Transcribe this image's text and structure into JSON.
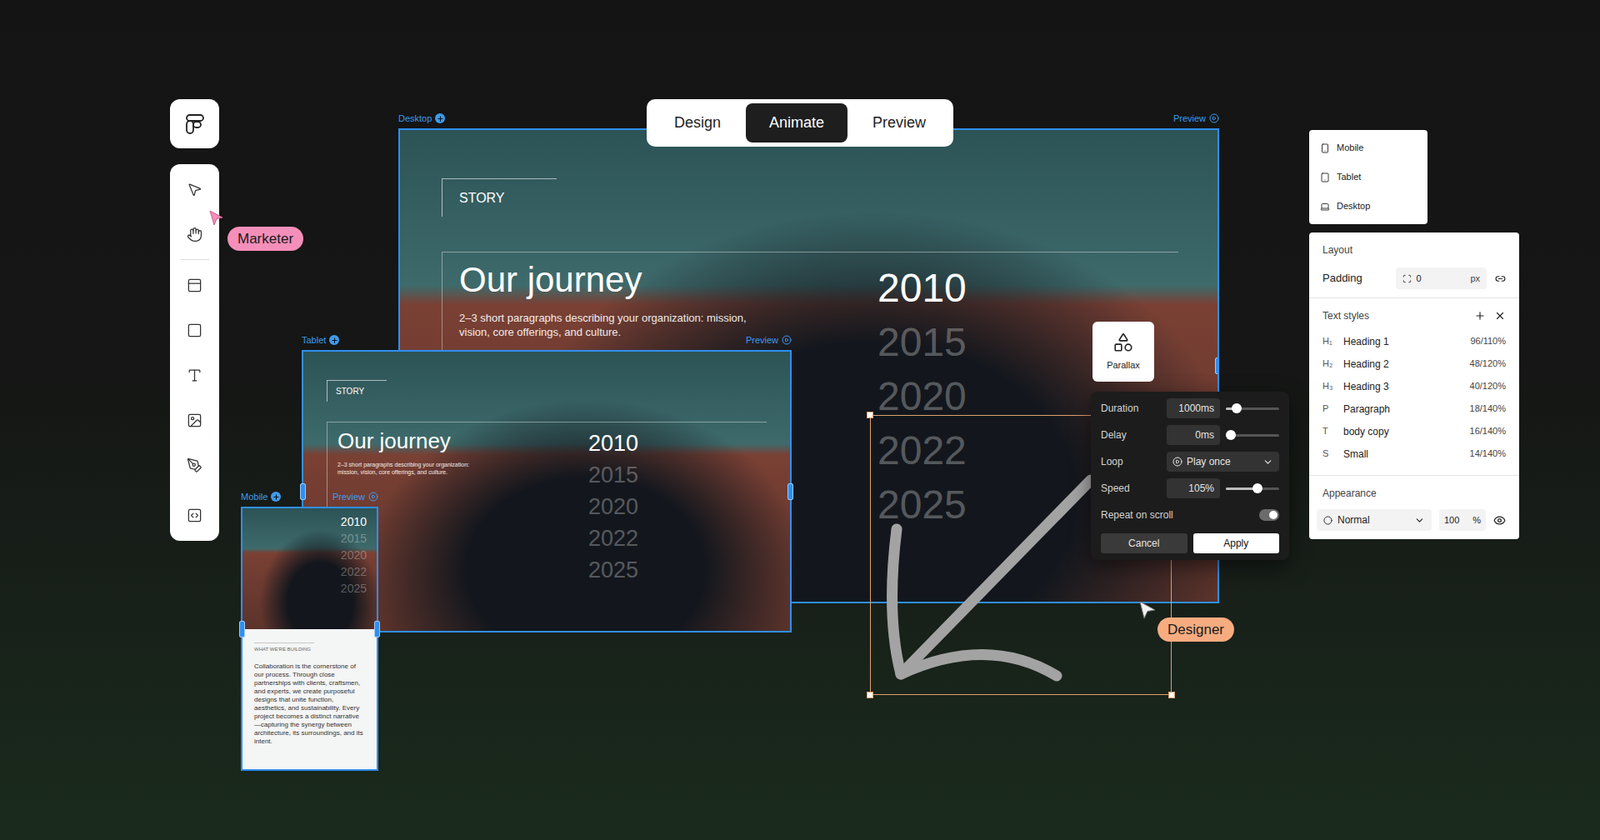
{
  "mode_tabs": [
    {
      "label": "Design",
      "selected": false
    },
    {
      "label": "Animate",
      "selected": true
    },
    {
      "label": "Preview",
      "selected": false
    }
  ],
  "cursors": [
    {
      "label": "Marketer",
      "color": "#f48fb9"
    },
    {
      "label": "Designer",
      "color": "#f7ac80"
    }
  ],
  "frames": {
    "desktop": {
      "label": "Desktop",
      "preview": "Preview",
      "section": "STORY",
      "heading": "Our journey",
      "body": "2–3 short paragraphs describing your organization: mission, vision, core offerings, and culture.",
      "years": [
        {
          "label": "2010",
          "selected": true
        },
        {
          "label": "2015",
          "selected": false
        },
        {
          "label": "2020",
          "selected": false
        },
        {
          "label": "2022",
          "selected": false
        },
        {
          "label": "2025",
          "selected": false
        }
      ]
    },
    "tablet": {
      "label": "Tablet",
      "preview": "Preview",
      "section": "STORY",
      "heading": "Our journey",
      "body": "2–3 short paragraphs describing your organization: mission, vision, core offerings, and culture.",
      "years": [
        {
          "label": "2010",
          "selected": true
        },
        {
          "label": "2015",
          "selected": false
        },
        {
          "label": "2020",
          "selected": false
        },
        {
          "label": "2022",
          "selected": false
        },
        {
          "label": "2025",
          "selected": false
        }
      ]
    },
    "mobile": {
      "label": "Mobile",
      "preview": "Preview",
      "years": [
        {
          "label": "2010",
          "selected": true
        },
        {
          "label": "2015",
          "selected": false
        },
        {
          "label": "2020",
          "selected": false
        },
        {
          "label": "2022",
          "selected": false
        },
        {
          "label": "2025",
          "selected": false
        }
      ],
      "card": {
        "eyebrow": "WHAT WE'RE BUILDING",
        "body": "Collaboration is the cornerstone of our process. Through close partnerships with clients, craftsmen, and experts, we create purposeful designs that unite function, aesthetics, and sustainability. Every project becomes a distinct narrative —capturing the synergy between architecture, its surroundings, and its intent."
      }
    }
  },
  "parallax": {
    "label": "Parallax"
  },
  "animation": {
    "fields": [
      {
        "label": "Duration",
        "value": "1000ms",
        "kind": "slider",
        "level": 0.2
      },
      {
        "label": "Delay",
        "value": "0ms",
        "kind": "slider",
        "level": 0
      },
      {
        "label": "Loop",
        "value": "Play once",
        "kind": "select"
      },
      {
        "label": "Speed",
        "value": "105%",
        "kind": "slider",
        "level": 0.6
      },
      {
        "label": "Repeat on scroll",
        "kind": "switch",
        "on": true
      }
    ],
    "buttons": [
      {
        "label": "Cancel",
        "primary": false
      },
      {
        "label": "Apply",
        "primary": true
      }
    ]
  },
  "devices": [
    {
      "label": "Mobile"
    },
    {
      "label": "Tablet"
    },
    {
      "label": "Desktop"
    }
  ],
  "inspector": {
    "layout": {
      "title": "Layout",
      "padding_label": "Padding",
      "padding_value": "0",
      "unit": "px"
    },
    "text_styles": {
      "title": "Text styles",
      "items": [
        {
          "tag": "H₁",
          "name": "Heading 1",
          "value": "96/110%"
        },
        {
          "tag": "H₂",
          "name": "Heading 2",
          "value": "48/120%"
        },
        {
          "tag": "H₃",
          "name": "Heading 3",
          "value": "40/120%"
        },
        {
          "tag": "P",
          "name": "Paragraph",
          "value": "18/140%"
        },
        {
          "tag": "T",
          "name": "body copy",
          "value": "16/140%"
        },
        {
          "tag": "S",
          "name": "Small",
          "value": "14/140%"
        }
      ]
    },
    "appearance": {
      "title": "Appearance",
      "blend": "Normal",
      "opacity": "100",
      "unit": "%"
    }
  }
}
